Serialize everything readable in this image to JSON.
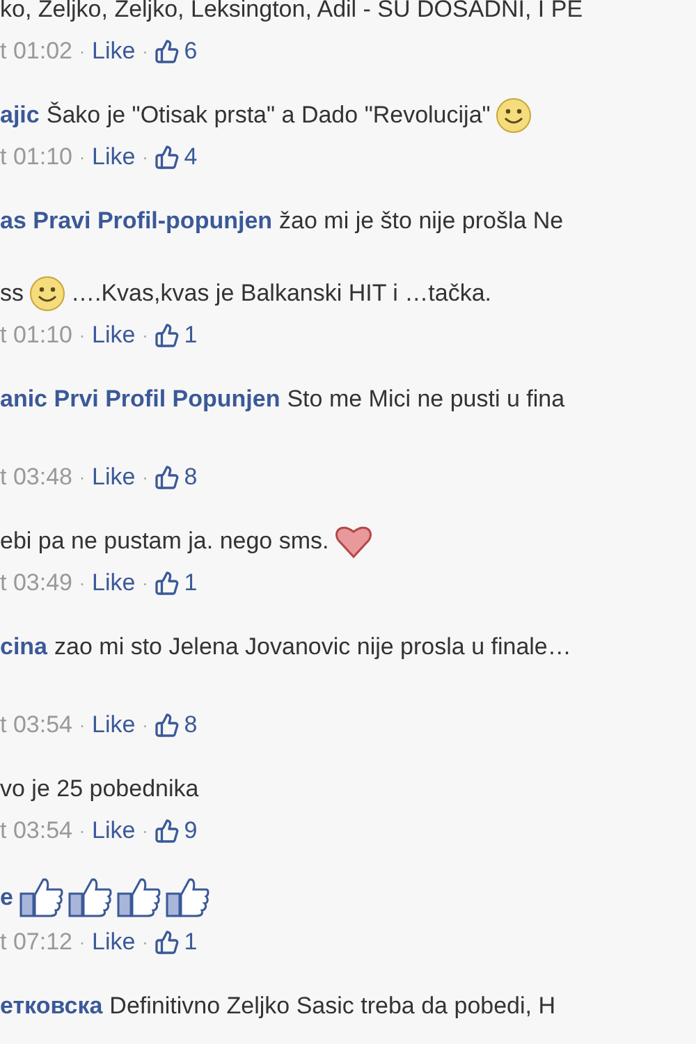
{
  "comments": [
    {
      "parts": [
        {
          "kind": "text",
          "text": "ko, Zeljko, Zeljko, Leksington, Adil - SU DOSADNI, I PE"
        }
      ],
      "meta": {
        "time": "t 01:02",
        "sep1": "·",
        "like": "Like",
        "sep2": "·",
        "count": "6"
      }
    },
    {
      "author": "ajic",
      "parts": [
        {
          "kind": "text",
          "text": "Šako je \"Otisak prsta\" a Dado \"Revolucija\""
        },
        {
          "kind": "smiley"
        }
      ],
      "meta": {
        "time": "t 01:10",
        "sep1": "·",
        "like": "Like",
        "sep2": "·",
        "count": "4"
      }
    },
    {
      "author": "as Pravi Profil-popunjen",
      "parts": [
        {
          "kind": "text",
          "text": "žao mi je što nije prošla Ne"
        },
        {
          "kind": "break"
        },
        {
          "kind": "text",
          "text": "ss"
        },
        {
          "kind": "smiley"
        },
        {
          "kind": "text",
          "text": "….Kvas,kvas je Balkanski HIT i …tačka."
        }
      ],
      "meta": {
        "time": "t 01:10",
        "sep1": "·",
        "like": "Like",
        "sep2": "·",
        "count": "1"
      }
    },
    {
      "author": "anic Prvi Profil Popunjen",
      "parts": [
        {
          "kind": "text",
          "text": "Sto me Mici ne pusti u fina"
        },
        {
          "kind": "break"
        }
      ],
      "meta": {
        "time": "t 03:48",
        "sep1": "·",
        "like": "Like",
        "sep2": "·",
        "count": "8"
      }
    },
    {
      "parts": [
        {
          "kind": "text",
          "text": "ebi pa ne pustam ja. nego sms."
        },
        {
          "kind": "heart"
        }
      ],
      "meta": {
        "time": "t 03:49",
        "sep1": "·",
        "like": "Like",
        "sep2": "·",
        "count": "1"
      }
    },
    {
      "author": "cina",
      "parts": [
        {
          "kind": "text",
          "text": "zao mi sto Jelena Jovanovic nije prosla u finale…"
        },
        {
          "kind": "break"
        }
      ],
      "meta": {
        "time": "t 03:54",
        "sep1": "·",
        "like": "Like",
        "sep2": "·",
        "count": "8"
      }
    },
    {
      "parts": [
        {
          "kind": "text",
          "text": "vo je 25 pobednika"
        }
      ],
      "meta": {
        "time": "t 03:54",
        "sep1": "·",
        "like": "Like",
        "sep2": "·",
        "count": "9"
      }
    },
    {
      "author": "e",
      "parts": [
        {
          "kind": "thumb"
        },
        {
          "kind": "thumb"
        },
        {
          "kind": "thumb"
        },
        {
          "kind": "thumb"
        }
      ],
      "meta": {
        "time": "t 07:12",
        "sep1": "·",
        "like": "Like",
        "sep2": "·",
        "count": "1"
      }
    },
    {
      "author": "етковска",
      "parts": [
        {
          "kind": "text",
          "text": "Definitivno Zeljko Sasic treba da pobedi, H"
        }
      ]
    }
  ]
}
